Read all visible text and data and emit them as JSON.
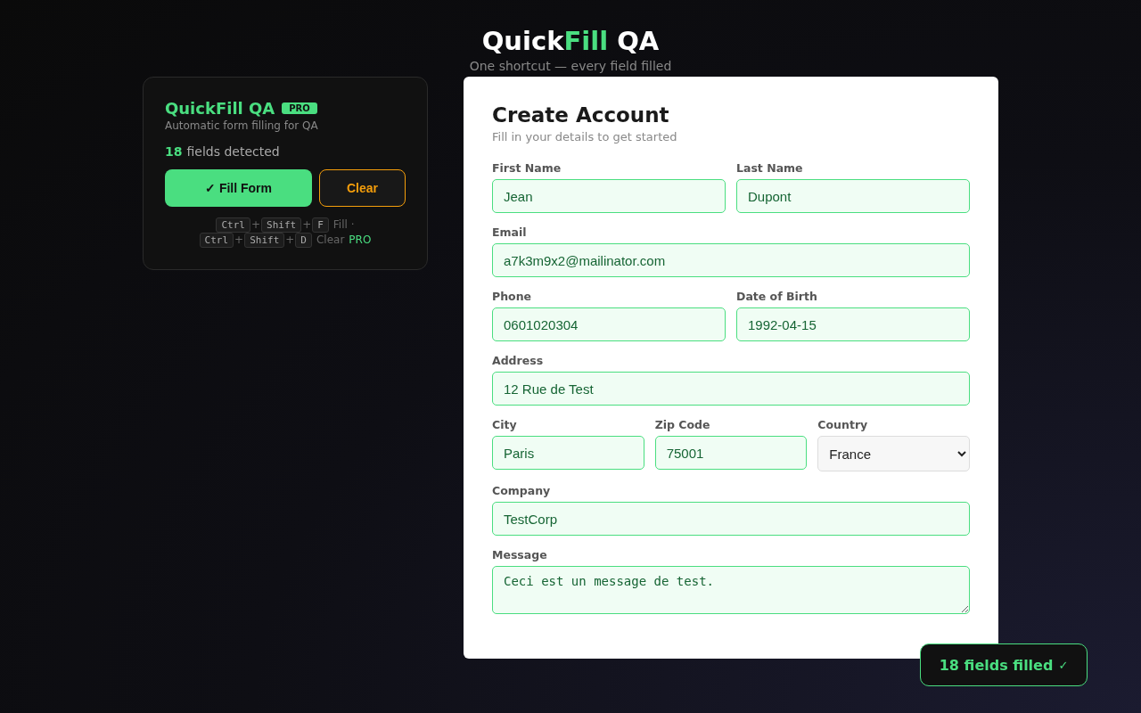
{
  "header": {
    "title_parts": [
      {
        "text": "Quick",
        "accent": false
      },
      {
        "text": "Fill",
        "accent": true
      },
      {
        "text": " QA",
        "accent": false
      }
    ],
    "subtitle": "One shortcut — every field filled"
  },
  "extension": {
    "name": "QuickFill QA",
    "badge": "PRO",
    "tagline": "Automatic form filling for QA",
    "count": "18",
    "count_label": "fields detected",
    "buttons": [
      {
        "label": "✓ Fill Form",
        "kind": "primary"
      },
      {
        "label": "Clear",
        "kind": "outline"
      }
    ],
    "shortcuts": [
      {
        "keys": [
          "Ctrl",
          "Shift",
          "F"
        ],
        "plus": "+",
        "action": "Fill ·"
      },
      {
        "keys": [
          "Ctrl",
          "Shift",
          "D"
        ],
        "plus": "+",
        "action": "Clear",
        "badge": "PRO"
      }
    ]
  },
  "form": {
    "title": "Create Account",
    "subtitle": "Fill in your details to get started",
    "rows": [
      [
        {
          "label": "First Name",
          "value": "Jean",
          "kind": "input",
          "filled": true
        },
        {
          "label": "Last Name",
          "value": "Dupont",
          "kind": "input",
          "filled": true
        }
      ],
      [
        {
          "label": "Email",
          "value": "a7k3m9x2@mailinator.com",
          "kind": "input",
          "filled": true
        }
      ],
      [
        {
          "label": "Phone",
          "value": "0601020304",
          "kind": "input",
          "filled": true
        },
        {
          "label": "Date of Birth",
          "value": "1992-04-15",
          "kind": "input",
          "filled": true
        }
      ],
      [
        {
          "label": "Address",
          "value": "12 Rue de Test",
          "kind": "input",
          "filled": true
        }
      ],
      [
        {
          "label": "City",
          "value": "Paris",
          "kind": "input",
          "filled": true
        },
        {
          "label": "Zip Code",
          "value": "75001",
          "kind": "input",
          "filled": true
        },
        {
          "label": "Country",
          "value": "France",
          "kind": "select",
          "filled": false
        }
      ],
      [
        {
          "label": "Company",
          "value": "TestCorp",
          "kind": "input",
          "filled": true
        }
      ],
      [
        {
          "label": "Message",
          "value": "Ceci est un message de test.",
          "kind": "textarea",
          "filled": true
        }
      ]
    ]
  },
  "toast": {
    "text": "18 fields filled",
    "mark": "✓"
  }
}
